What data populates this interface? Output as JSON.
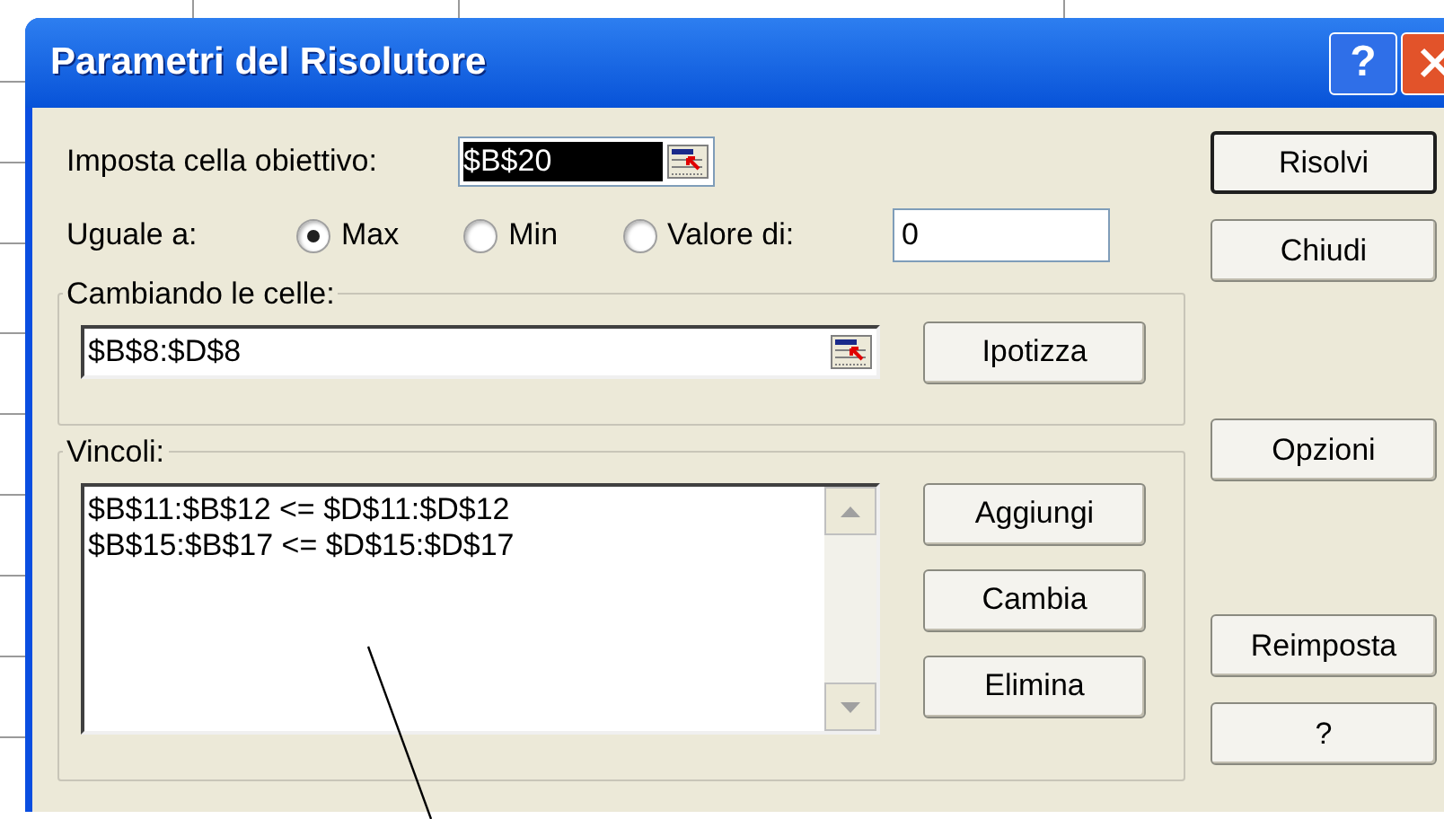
{
  "window": {
    "title": "Parametri del Risolutore",
    "title_buttons": [
      {
        "kind": "help",
        "label": "?"
      },
      {
        "kind": "close"
      }
    ]
  },
  "target_cell": {
    "label": "Imposta cella obiettivo:",
    "value": "$B$20",
    "selected": true
  },
  "equal_to": {
    "label": "Uguale a:",
    "options": [
      {
        "label": "Max",
        "selected": true
      },
      {
        "label": "Min",
        "selected": false
      },
      {
        "label": "Valore di:",
        "selected": false
      }
    ],
    "value": "0"
  },
  "changing_cells": {
    "label": "Cambiando le celle:",
    "value": "$B$8:$D$8",
    "button": "Ipotizza"
  },
  "constraints": {
    "label": "Vincoli:",
    "items": [
      "$B$11:$B$12 <= $D$11:$D$12",
      "$B$15:$B$17 <= $D$15:$D$17"
    ],
    "buttons": [
      "Aggiungi",
      "Cambia",
      "Elimina"
    ]
  },
  "side_buttons": [
    [
      {
        "label": "Risolvi",
        "default": true
      },
      {
        "label": "Chiudi",
        "default": false
      }
    ],
    [
      {
        "label": "Opzioni",
        "default": false
      }
    ],
    [
      {
        "label": "Reimposta",
        "default": false
      },
      {
        "label": "?",
        "default": false
      }
    ]
  ]
}
